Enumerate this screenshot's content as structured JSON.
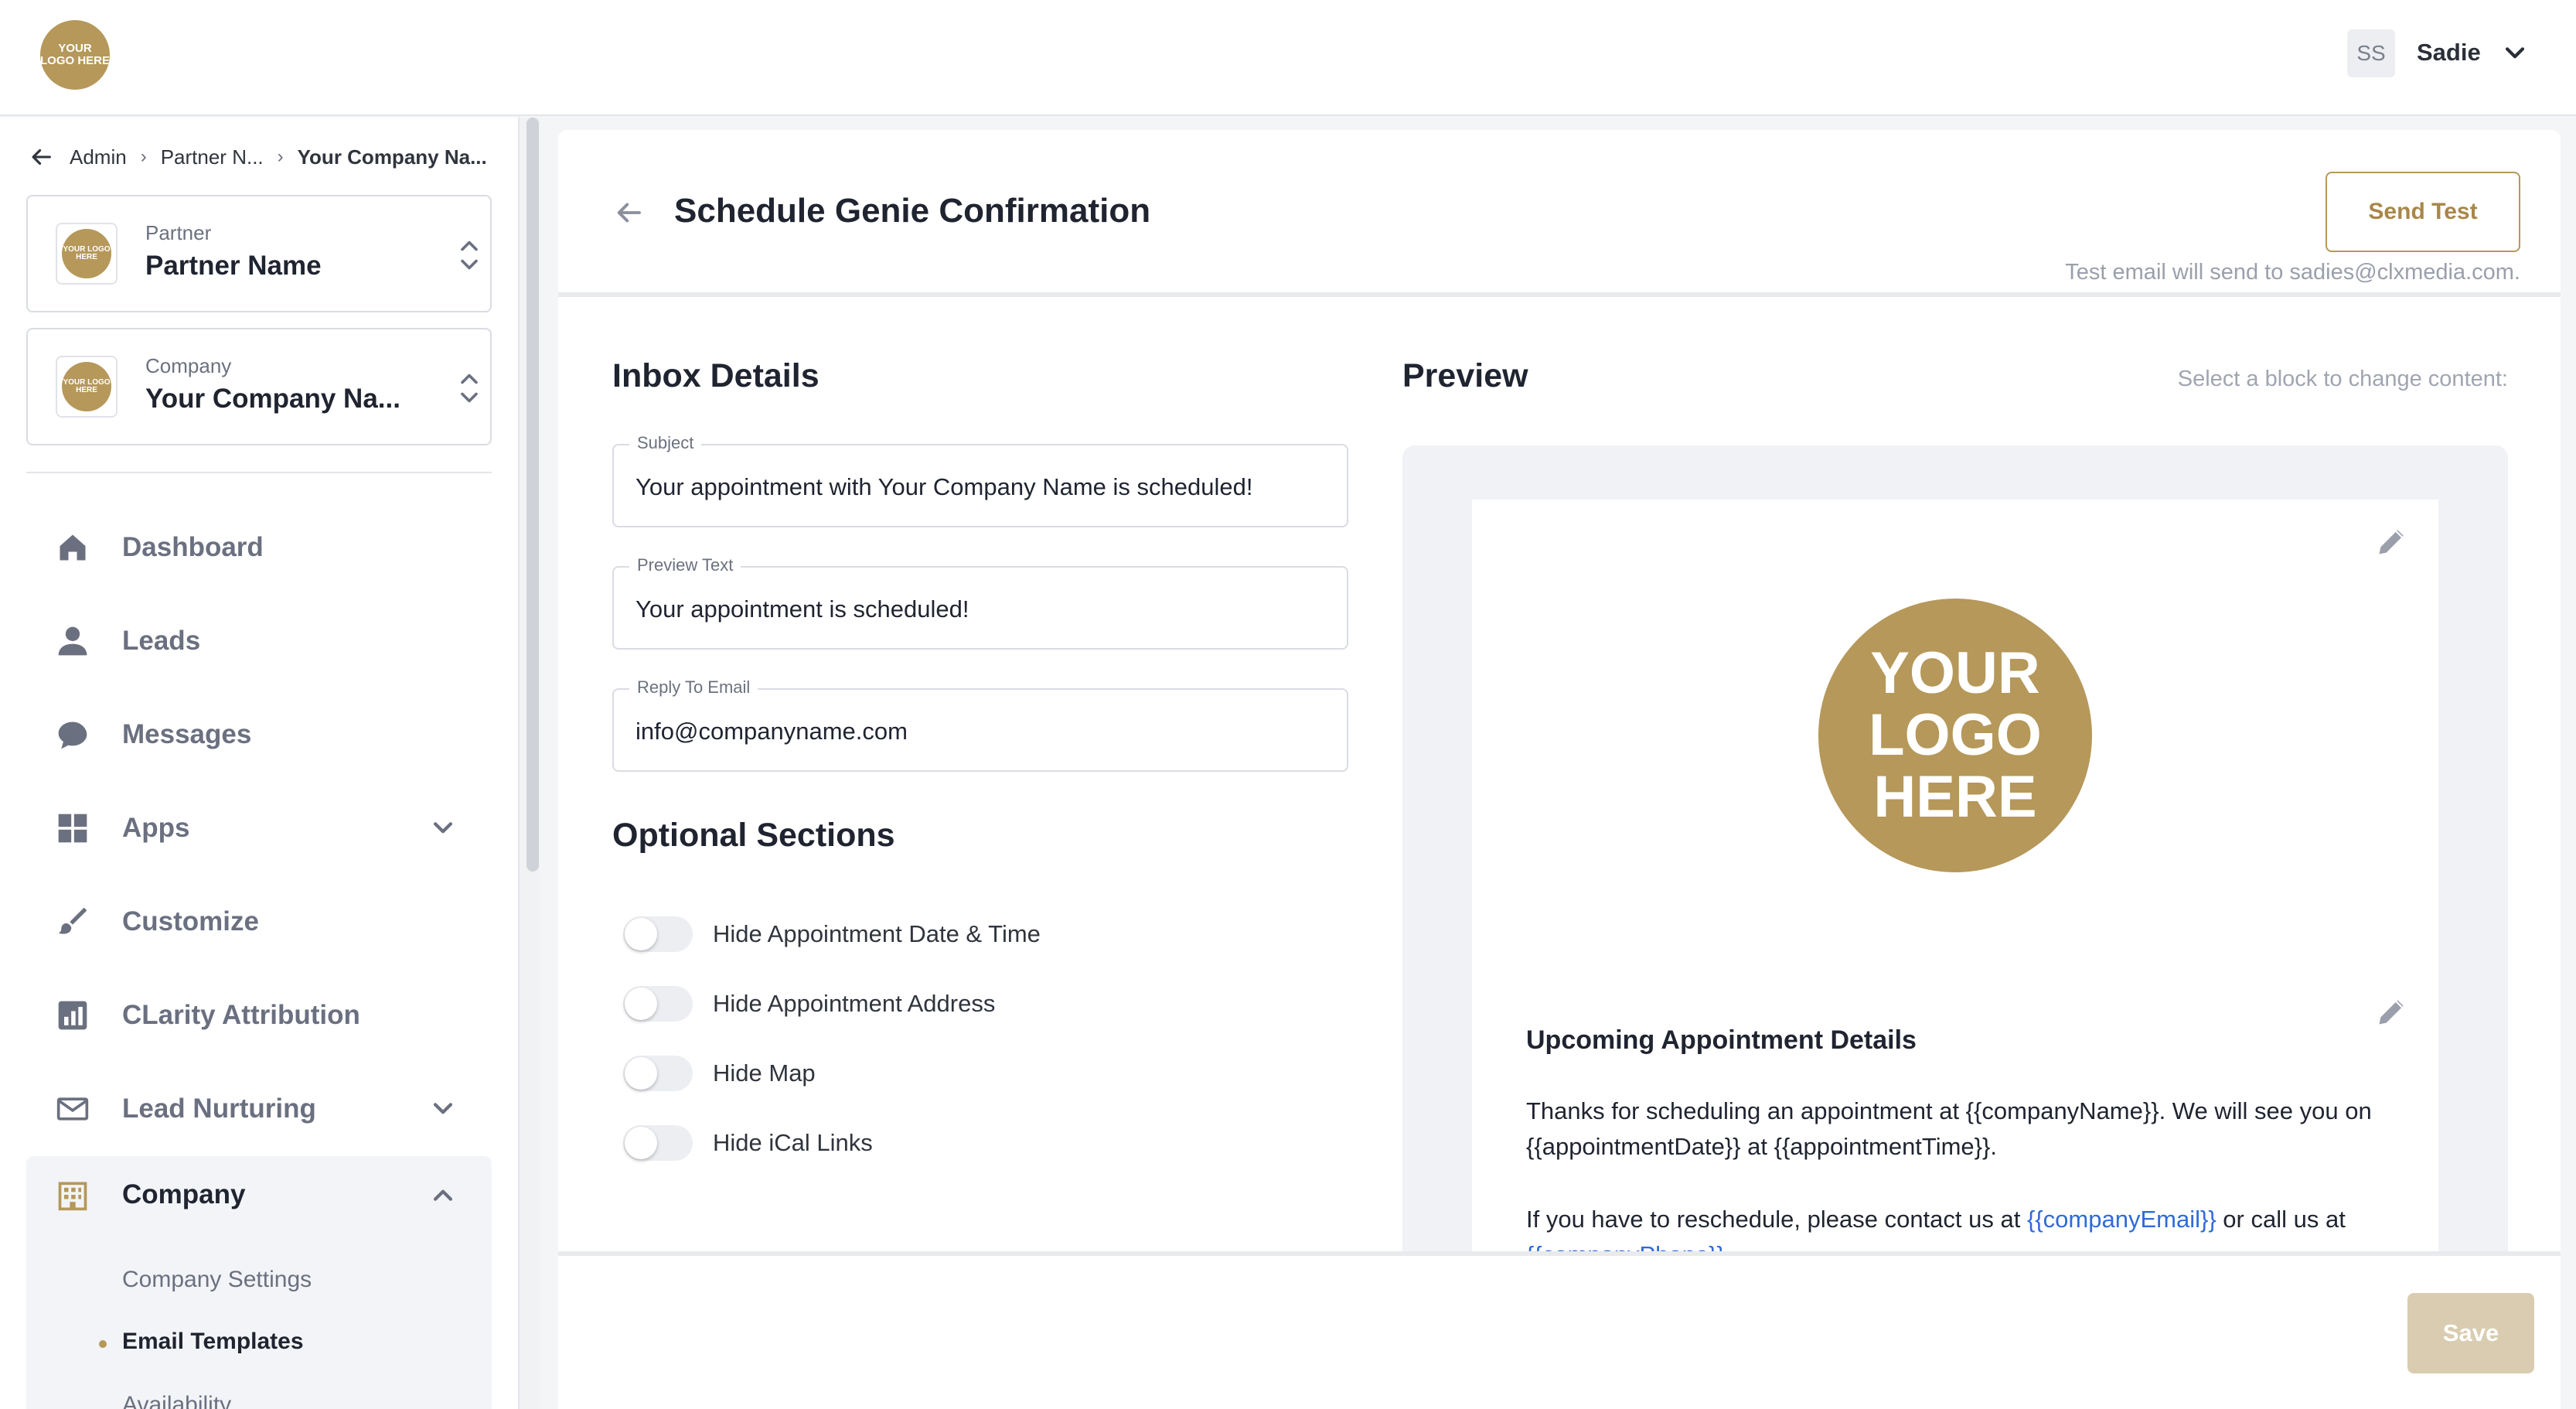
{
  "brand": {
    "logo_text": "YOUR LOGO HERE",
    "accent": "#b5985a"
  },
  "user": {
    "initials": "SS",
    "name": "Sadie"
  },
  "breadcrumb": [
    "Admin",
    "Partner N...",
    "Your Company Na..."
  ],
  "selectors": {
    "partner": {
      "kind": "Partner",
      "value": "Partner Name"
    },
    "company": {
      "kind": "Company",
      "value": "Your Company Na..."
    }
  },
  "nav": [
    {
      "label": "Dashboard",
      "icon": "home-icon"
    },
    {
      "label": "Leads",
      "icon": "person-icon"
    },
    {
      "label": "Messages",
      "icon": "chat-bubble-icon"
    },
    {
      "label": "Apps",
      "icon": "grid-icon",
      "expandable": true
    },
    {
      "label": "Customize",
      "icon": "paintbrush-icon"
    },
    {
      "label": "CLarity Attribution",
      "icon": "bar-chart-icon"
    },
    {
      "label": "Lead Nurturing",
      "icon": "envelope-icon",
      "expandable": true
    },
    {
      "label": "Company",
      "icon": "building-icon",
      "expanded": true
    }
  ],
  "company_sub": [
    "Company Settings",
    "Email Templates",
    "Availability"
  ],
  "page": {
    "title": "Schedule Genie Confirmation",
    "send_test_label": "Send Test",
    "send_note": "Test email will send to sadies@clxmedia.com."
  },
  "inbox": {
    "heading": "Inbox Details",
    "subject_label": "Subject",
    "subject_value": "Your appointment with Your Company Name is scheduled!",
    "preview_label": "Preview Text",
    "preview_value": "Your appointment is scheduled!",
    "reply_label": "Reply To Email",
    "reply_value": "info@companyname.com"
  },
  "optional": {
    "heading": "Optional Sections",
    "toggles": [
      "Hide Appointment Date & Time",
      "Hide Appointment Address",
      "Hide Map",
      "Hide iCal Links"
    ]
  },
  "preview": {
    "heading": "Preview",
    "hint": "Select a block to change content:",
    "logo_text": "YOUR LOGO HERE",
    "email_heading": "Upcoming Appointment Details",
    "para1": "Thanks for scheduling an appointment at {{companyName}}. We will see you on {{appointmentDate}} at {{appointmentTime}}.",
    "para2_before": "If you have to reschedule, please contact us at ",
    "para2_email": "{{companyEmail}}",
    "para2_mid": " or call us at ",
    "para2_phone": "{{companyPhone}}"
  },
  "footer": {
    "save_label": "Save"
  }
}
